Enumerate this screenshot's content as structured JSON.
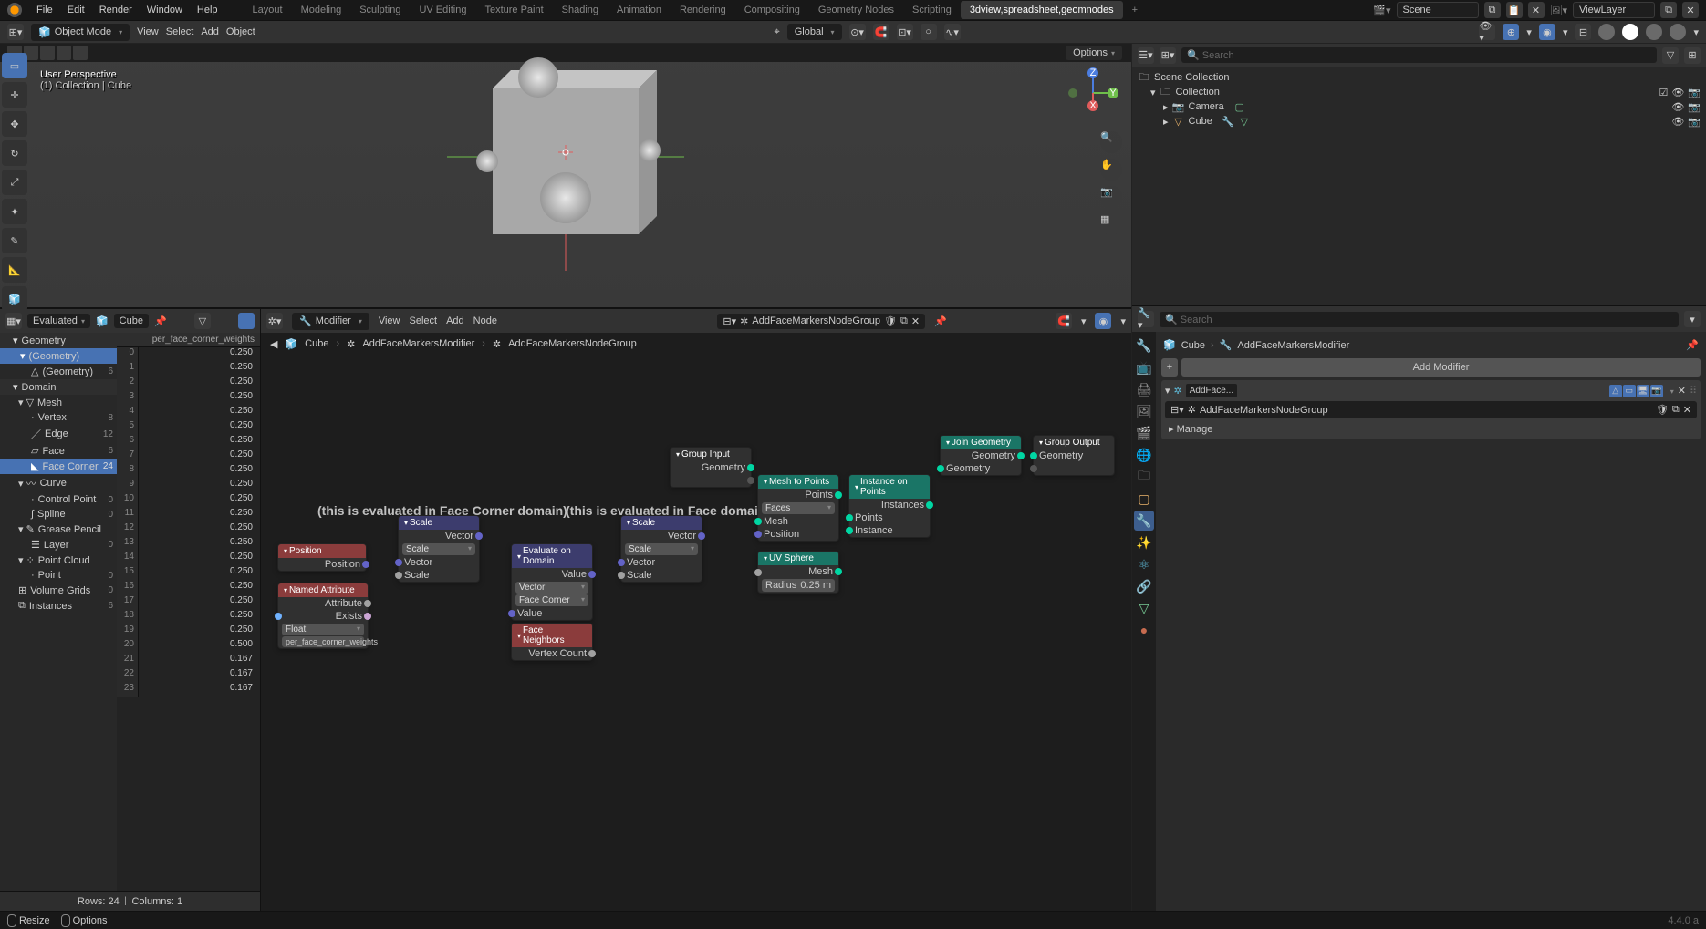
{
  "topmenu": {
    "file": "File",
    "edit": "Edit",
    "render": "Render",
    "window": "Window",
    "help": "Help"
  },
  "workspaces": [
    "Layout",
    "Modeling",
    "Sculpting",
    "UV Editing",
    "Texture Paint",
    "Shading",
    "Animation",
    "Rendering",
    "Compositing",
    "Geometry Nodes",
    "Scripting",
    "3dview,spreadsheet,geomnodes"
  ],
  "scene_label": "Scene",
  "viewlayer_label": "ViewLayer",
  "viewport": {
    "mode": "Object Mode",
    "menu_view": "View",
    "menu_select": "Select",
    "menu_add": "Add",
    "menu_object": "Object",
    "orient": "Global",
    "persp": "User Perspective",
    "context": "(1) Collection | Cube",
    "options": "Options"
  },
  "spreadsheet": {
    "eval": "Evaluated",
    "object": "Cube",
    "column_header": "per_face_corner_weights",
    "tree": {
      "geometry": "Geometry",
      "geometry_sub": "(Geometry)",
      "geometry_sub2": "(Geometry)",
      "geo_count": "6",
      "domain": "Domain",
      "mesh": "Mesh",
      "vertex": "Vertex",
      "vertex_c": "8",
      "edge": "Edge",
      "edge_c": "12",
      "face": "Face",
      "face_c": "6",
      "facecorner": "Face Corner",
      "facecorner_c": "24",
      "curve": "Curve",
      "ctrlpt": "Control Point",
      "ctrlpt_c": "0",
      "spline": "Spline",
      "spline_c": "0",
      "gp": "Grease Pencil",
      "layer": "Layer",
      "layer_c": "0",
      "pc": "Point Cloud",
      "point": "Point",
      "point_c": "0",
      "vg": "Volume Grids",
      "vg_c": "0",
      "inst": "Instances",
      "inst_c": "6"
    },
    "rows": [
      {
        "i": "0",
        "v": "0.250"
      },
      {
        "i": "1",
        "v": "0.250"
      },
      {
        "i": "2",
        "v": "0.250"
      },
      {
        "i": "3",
        "v": "0.250"
      },
      {
        "i": "4",
        "v": "0.250"
      },
      {
        "i": "5",
        "v": "0.250"
      },
      {
        "i": "6",
        "v": "0.250"
      },
      {
        "i": "7",
        "v": "0.250"
      },
      {
        "i": "8",
        "v": "0.250"
      },
      {
        "i": "9",
        "v": "0.250"
      },
      {
        "i": "10",
        "v": "0.250"
      },
      {
        "i": "11",
        "v": "0.250"
      },
      {
        "i": "12",
        "v": "0.250"
      },
      {
        "i": "13",
        "v": "0.250"
      },
      {
        "i": "14",
        "v": "0.250"
      },
      {
        "i": "15",
        "v": "0.250"
      },
      {
        "i": "16",
        "v": "0.250"
      },
      {
        "i": "17",
        "v": "0.250"
      },
      {
        "i": "18",
        "v": "0.250"
      },
      {
        "i": "19",
        "v": "0.250"
      },
      {
        "i": "20",
        "v": "0.500"
      },
      {
        "i": "21",
        "v": "0.167"
      },
      {
        "i": "22",
        "v": "0.167"
      },
      {
        "i": "23",
        "v": "0.167"
      }
    ],
    "footer_rows": "Rows: 24",
    "footer_cols": "Columns: 1"
  },
  "node_editor": {
    "mode": "Modifier",
    "menu_view": "View",
    "menu_select": "Select",
    "menu_add": "Add",
    "menu_node": "Node",
    "nodegroup": "AddFaceMarkersNodeGroup",
    "breadcrumb": {
      "cube": "Cube",
      "mod": "AddFaceMarkersModifier",
      "ng": "AddFaceMarkersNodeGroup"
    },
    "annot1": "(this is evaluated in Face Corner domain)",
    "annot2": "(this is evaluated in Face domain)",
    "nodes": {
      "position": {
        "title": "Position",
        "out_position": "Position"
      },
      "named_attr": {
        "title": "Named Attribute",
        "out_attr": "Attribute",
        "out_exists": "Exists",
        "type": "Float",
        "name": "per_face_corner_weights"
      },
      "scale1": {
        "title": "Scale",
        "out_vector": "Vector",
        "mode": "Scale",
        "in_vector": "Vector",
        "in_scale": "Scale"
      },
      "eval_domain": {
        "title": "Evaluate on Domain",
        "out_value": "Value",
        "type": "Vector",
        "domain": "Face Corner",
        "in_value": "Value"
      },
      "face_neighbors": {
        "title": "Face Neighbors",
        "out_vc": "Vertex Count"
      },
      "scale2": {
        "title": "Scale",
        "out_vector": "Vector",
        "mode": "Scale",
        "in_vector": "Vector",
        "in_scale": "Scale"
      },
      "group_input": {
        "title": "Group Input",
        "out_geom": "Geometry"
      },
      "mesh_to_points": {
        "title": "Mesh to Points",
        "out_points": "Points",
        "mode": "Faces",
        "in_mesh": "Mesh",
        "in_position": "Position"
      },
      "uv_sphere": {
        "title": "UV Sphere",
        "out_mesh": "Mesh",
        "radius_label": "Radius",
        "radius_val": "0.25 m"
      },
      "instance_on_points": {
        "title": "Instance on Points",
        "out_inst": "Instances",
        "in_points": "Points",
        "in_instance": "Instance"
      },
      "join_geom": {
        "title": "Join Geometry",
        "out_geom": "Geometry",
        "in_geom": "Geometry"
      },
      "group_output": {
        "title": "Group Output",
        "in_geom": "Geometry"
      }
    }
  },
  "outliner": {
    "search_ph": "Search",
    "scene_collection": "Scene Collection",
    "collection": "Collection",
    "camera": "Camera",
    "cube": "Cube"
  },
  "properties": {
    "search_ph": "Search",
    "cube": "Cube",
    "mod": "AddFaceMarkersModifier",
    "add_modifier": "Add Modifier",
    "mod_name": "AddFace...",
    "nodegroup": "AddFaceMarkersNodeGroup",
    "manage": "Manage"
  },
  "statusbar": {
    "resize": "Resize",
    "options": "Options",
    "version": "4.4.0 a"
  }
}
